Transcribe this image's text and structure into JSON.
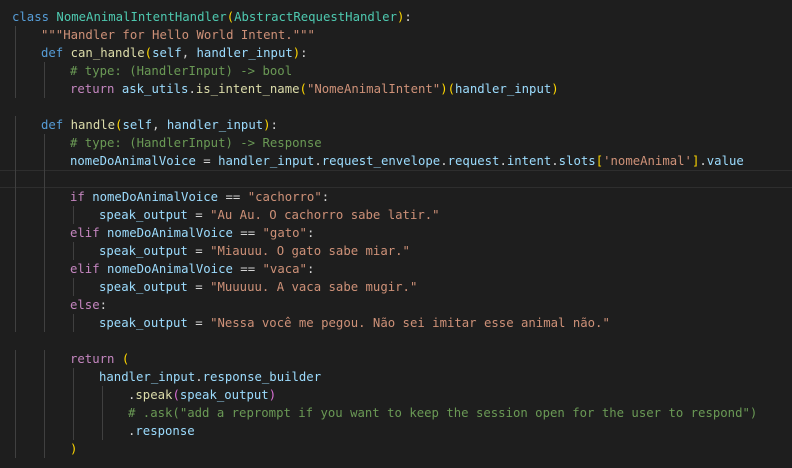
{
  "colors": {
    "background": "#1e1e1e",
    "keyword": "#569cd6",
    "control": "#c586c0",
    "function": "#dcdcaa",
    "class": "#4ec9b0",
    "variable": "#9cdcfe",
    "string": "#ce9178",
    "comment": "#6a9955",
    "plain": "#d4d4d4",
    "bracket1": "#ffd700",
    "bracket2": "#da70d6",
    "bracket3": "#179fff"
  },
  "lines": [
    {
      "indent": 0,
      "tokens": [
        [
          "class ",
          "keyword"
        ],
        [
          "NomeAnimalIntentHandler",
          "class"
        ],
        [
          "(",
          "bracket1"
        ],
        [
          "AbstractRequestHandler",
          "class"
        ],
        [
          ")",
          "bracket1"
        ],
        [
          ":",
          "plain"
        ]
      ]
    },
    {
      "indent": 1,
      "tokens": [
        [
          "\"\"\"Handler for Hello World Intent.\"\"\"",
          "string"
        ]
      ]
    },
    {
      "indent": 1,
      "tokens": [
        [
          "def ",
          "keyword"
        ],
        [
          "can_handle",
          "function"
        ],
        [
          "(",
          "bracket1"
        ],
        [
          "self",
          "variable"
        ],
        [
          ", ",
          "plain"
        ],
        [
          "handler_input",
          "variable"
        ],
        [
          ")",
          "bracket1"
        ],
        [
          ":",
          "plain"
        ]
      ]
    },
    {
      "indent": 2,
      "tokens": [
        [
          "# type: (HandlerInput) -> bool",
          "comment"
        ]
      ]
    },
    {
      "indent": 2,
      "tokens": [
        [
          "return ",
          "control"
        ],
        [
          "ask_utils",
          "variable"
        ],
        [
          ".",
          "plain"
        ],
        [
          "is_intent_name",
          "function"
        ],
        [
          "(",
          "bracket1"
        ],
        [
          "\"NomeAnimalIntent\"",
          "string"
        ],
        [
          ")",
          "bracket1"
        ],
        [
          "(",
          "bracket1"
        ],
        [
          "handler_input",
          "variable"
        ],
        [
          ")",
          "bracket1"
        ]
      ]
    },
    {
      "indent": 0,
      "tokens": []
    },
    {
      "indent": 1,
      "tokens": [
        [
          "def ",
          "keyword"
        ],
        [
          "handle",
          "function"
        ],
        [
          "(",
          "bracket1"
        ],
        [
          "self",
          "variable"
        ],
        [
          ", ",
          "plain"
        ],
        [
          "handler_input",
          "variable"
        ],
        [
          ")",
          "bracket1"
        ],
        [
          ":",
          "plain"
        ]
      ]
    },
    {
      "indent": 2,
      "tokens": [
        [
          "# type: (HandlerInput) -> Response",
          "comment"
        ]
      ]
    },
    {
      "indent": 2,
      "tokens": [
        [
          "nomeDoAnimalVoice",
          "variable"
        ],
        [
          " = ",
          "plain"
        ],
        [
          "handler_input",
          "variable"
        ],
        [
          ".",
          "plain"
        ],
        [
          "request_envelope",
          "variable"
        ],
        [
          ".",
          "plain"
        ],
        [
          "request",
          "variable"
        ],
        [
          ".",
          "plain"
        ],
        [
          "intent",
          "variable"
        ],
        [
          ".",
          "plain"
        ],
        [
          "slots",
          "variable"
        ],
        [
          "[",
          "bracket1"
        ],
        [
          "'nomeAnimal'",
          "string"
        ],
        [
          "]",
          "bracket1"
        ],
        [
          ".",
          "plain"
        ],
        [
          "value",
          "variable"
        ]
      ]
    },
    {
      "indent": 2,
      "cursor": true,
      "tokens": []
    },
    {
      "indent": 2,
      "tokens": [
        [
          "if ",
          "control"
        ],
        [
          "nomeDoAnimalVoice",
          "variable"
        ],
        [
          " == ",
          "plain"
        ],
        [
          "\"cachorro\"",
          "string"
        ],
        [
          ":",
          "plain"
        ]
      ]
    },
    {
      "indent": 3,
      "tokens": [
        [
          "speak_output",
          "variable"
        ],
        [
          " = ",
          "plain"
        ],
        [
          "\"Au Au. O cachorro sabe latir.\"",
          "string"
        ]
      ]
    },
    {
      "indent": 2,
      "tokens": [
        [
          "elif ",
          "control"
        ],
        [
          "nomeDoAnimalVoice",
          "variable"
        ],
        [
          " == ",
          "plain"
        ],
        [
          "\"gato\"",
          "string"
        ],
        [
          ":",
          "plain"
        ]
      ]
    },
    {
      "indent": 3,
      "tokens": [
        [
          "speak_output",
          "variable"
        ],
        [
          " = ",
          "plain"
        ],
        [
          "\"Miauuu. O gato sabe miar.\"",
          "string"
        ]
      ]
    },
    {
      "indent": 2,
      "tokens": [
        [
          "elif ",
          "control"
        ],
        [
          "nomeDoAnimalVoice",
          "variable"
        ],
        [
          " == ",
          "plain"
        ],
        [
          "\"vaca\"",
          "string"
        ],
        [
          ":",
          "plain"
        ]
      ]
    },
    {
      "indent": 3,
      "tokens": [
        [
          "speak_output",
          "variable"
        ],
        [
          " = ",
          "plain"
        ],
        [
          "\"Muuuuu. A vaca sabe mugir.\"",
          "string"
        ]
      ]
    },
    {
      "indent": 2,
      "tokens": [
        [
          "else",
          "control"
        ],
        [
          ":",
          "plain"
        ]
      ]
    },
    {
      "indent": 3,
      "tokens": [
        [
          "speak_output",
          "variable"
        ],
        [
          " = ",
          "plain"
        ],
        [
          "\"Nessa você me pegou. Não sei imitar esse animal não.\"",
          "string"
        ]
      ]
    },
    {
      "indent": 0,
      "tokens": []
    },
    {
      "indent": 2,
      "tokens": [
        [
          "return ",
          "control"
        ],
        [
          "(",
          "bracket1"
        ]
      ]
    },
    {
      "indent": 3,
      "tokens": [
        [
          "handler_input",
          "variable"
        ],
        [
          ".",
          "plain"
        ],
        [
          "response_builder",
          "variable"
        ]
      ]
    },
    {
      "indent": 4,
      "tokens": [
        [
          ".",
          "plain"
        ],
        [
          "speak",
          "function"
        ],
        [
          "(",
          "bracket2"
        ],
        [
          "speak_output",
          "variable"
        ],
        [
          ")",
          "bracket2"
        ]
      ]
    },
    {
      "indent": 4,
      "tokens": [
        [
          "# .ask(\"add a reprompt if you want to keep the session open for the user to respond\")",
          "comment"
        ]
      ]
    },
    {
      "indent": 4,
      "tokens": [
        [
          ".",
          "plain"
        ],
        [
          "response",
          "variable"
        ]
      ]
    },
    {
      "indent": 2,
      "tokens": [
        [
          ")",
          "bracket1"
        ]
      ]
    }
  ]
}
